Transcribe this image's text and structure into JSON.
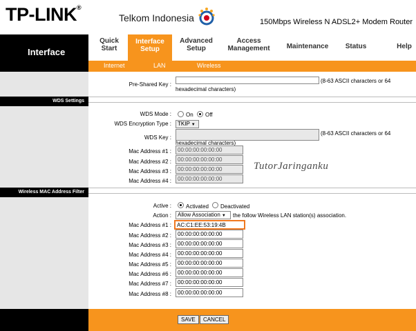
{
  "header": {
    "brand": "TP-LINK",
    "partner": "Telkom Indonesia",
    "product": "150Mbps Wireless N ADSL2+ Modem Router"
  },
  "nav": {
    "section": "Interface",
    "items": [
      {
        "line1": "Quick",
        "line2": "Start"
      },
      {
        "line1": "Interface",
        "line2": "Setup"
      },
      {
        "line1": "Advanced",
        "line2": "Setup"
      },
      {
        "line1": "Access",
        "line2": "Management"
      },
      {
        "line1": "Maintenance",
        "line2": ""
      },
      {
        "line1": "Status",
        "line2": ""
      },
      {
        "line1": "Help",
        "line2": ""
      }
    ],
    "sub": [
      "Internet",
      "LAN",
      "Wireless"
    ]
  },
  "psk": {
    "label": "Pre-Shared Key :",
    "hint1": "(8-63 ASCII characters or 64",
    "hint2": "hexadecimal characters)"
  },
  "wds": {
    "section": "WDS Settings",
    "mode_label": "WDS Mode :",
    "on": "On",
    "off": "Off",
    "enc_label": "WDS Encryption Type :",
    "enc_value": "TKIP",
    "key_label": "WDS Key :",
    "key_hint1": "(8-63 ASCII characters or 64",
    "key_hint2": "hexadecimal characters)",
    "macs": [
      {
        "label": "Mac Address #1 :",
        "value": "00:00:00:00:00:00"
      },
      {
        "label": "Mac Address #2 :",
        "value": "00:00:00:00:00:00"
      },
      {
        "label": "Mac Address #3 :",
        "value": "00:00:00:00:00:00"
      },
      {
        "label": "Mac Address #4 :",
        "value": "00:00:00:00:00:00"
      }
    ]
  },
  "watermark": "TutorJaringanku",
  "filter": {
    "section": "Wireless MAC Address Filter",
    "active_label": "Active :",
    "activated": "Activated",
    "deactivated": "Deactivated",
    "action_label": "Action :",
    "action_value": "Allow Association",
    "action_hint": "the follow Wireless LAN station(s) association.",
    "macs": [
      {
        "label": "Mac Address #1 :",
        "value": "AC:C1:EE:53:19:4B"
      },
      {
        "label": "Mac Address #2 :",
        "value": "00:00:00:00:00:00"
      },
      {
        "label": "Mac Address #3 :",
        "value": "00:00:00:00:00:00"
      },
      {
        "label": "Mac Address #4 :",
        "value": "00:00:00:00:00:00"
      },
      {
        "label": "Mac Address #5 :",
        "value": "00:00:00:00:00:00"
      },
      {
        "label": "Mac Address #6 :",
        "value": "00:00:00:00:00:00"
      },
      {
        "label": "Mac Address #7 :",
        "value": "00:00:00:00:00:00"
      },
      {
        "label": "Mac Address #8 :",
        "value": "00:00:00:00:00:00"
      }
    ]
  },
  "buttons": {
    "save": "SAVE",
    "cancel": "CANCEL"
  }
}
